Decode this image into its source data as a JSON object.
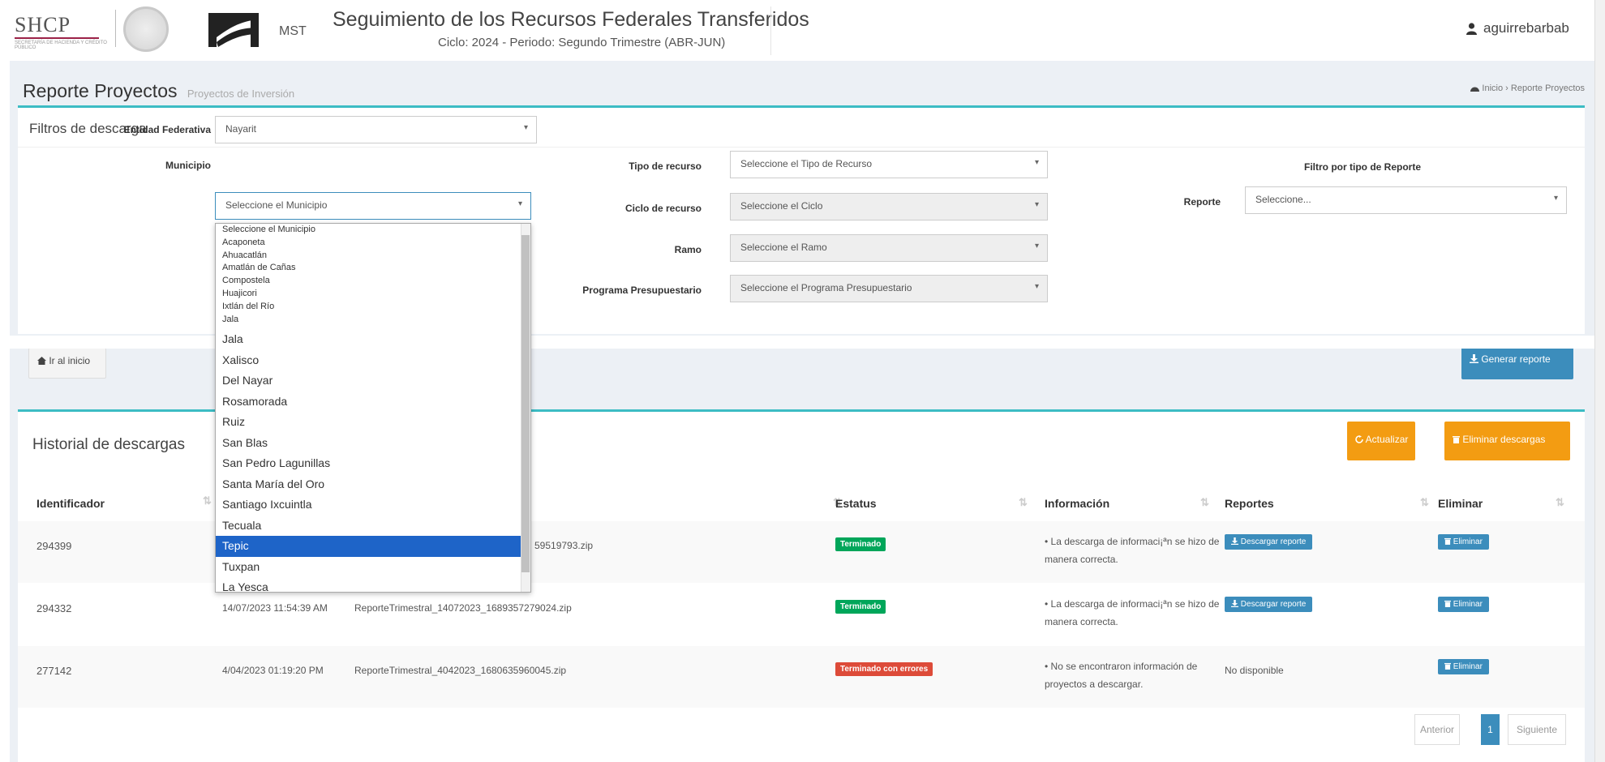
{
  "header": {
    "shcp_logo": "SHCP",
    "shcp_logo_sub": "SECRETARÍA DE HACIENDA Y CRÉDITO PÚBLICO",
    "mst_label": "MST",
    "title": "Seguimiento de los Recursos Federales Transferidos",
    "subtitle": "Ciclo: 2024 - Periodo: Segundo Trimestre (ABR-JUN)",
    "user": "aguirrebarbab",
    "user_icon": "user-icon"
  },
  "page": {
    "title": "Reporte Proyectos",
    "subtitle": "Proyectos de Inversión",
    "breadcrumb_home": "Inicio",
    "breadcrumb_current": "Reporte Proyectos",
    "breadcrumb_sep": "›",
    "home_icon": "dashboard-icon"
  },
  "filters": {
    "box_title": "Filtros de descarga",
    "entidad_label": "Entidad Federativa",
    "entidad_value": "Nayarit",
    "municipio_label": "Municipio",
    "municipio_placeholder": "Seleccione el Municipio",
    "tipo_label": "Tipo de recurso",
    "tipo_placeholder": "Seleccione el Tipo de Recurso",
    "ciclo_label": "Ciclo de recurso",
    "ciclo_placeholder": "Seleccione el Ciclo",
    "ramo_label": "Ramo",
    "ramo_placeholder": "Seleccione el Ramo",
    "programa_label": "Programa Presupuestario",
    "programa_placeholder": "Seleccione el Programa Presupuestario",
    "filtro_reporte_heading": "Filtro por tipo de Reporte",
    "reporte_label": "Reporte",
    "reporte_placeholder": "Seleccione...",
    "caret": "▾"
  },
  "municipio_options": {
    "small": [
      "Seleccione el Municipio",
      "Acaponeta",
      "Ahuacatlán",
      "Amatlán de Cañas",
      "Compostela",
      "Huajicori",
      "Ixtlán del Río",
      "Jala"
    ],
    "large": [
      "Jala",
      "Xalisco",
      "Del Nayar",
      "Rosamorada",
      "Ruiz",
      "San Blas",
      "San Pedro Lagunillas",
      "Santa María del Oro",
      "Santiago Ixcuintla",
      "Tecuala",
      "Tepic",
      "Tuxpan",
      "La Yesca"
    ],
    "selected": "Tepic"
  },
  "actions": {
    "home_button": "Ir al inicio",
    "home_button_icon": "home-icon",
    "generate_button": "Generar reporte",
    "generate_icon": "download-icon"
  },
  "history": {
    "title": "Historial de descargas",
    "refresh_button": "Actualizar",
    "refresh_icon": "refresh-icon",
    "delete_all_button": "Eliminar descargas",
    "delete_icon": "trash-icon",
    "columns": [
      "Identificador",
      "Estatus",
      "Información",
      "Reportes",
      "Eliminar"
    ],
    "sort_icon": "⇅",
    "rows": [
      {
        "id": "294399",
        "date": "",
        "file": "59519793.zip",
        "status": "Terminado",
        "status_color": "#00a65a",
        "info": "• La descarga de informaci¡ªn se hizo de manera correcta.",
        "report": "Descargar reporte",
        "delete": "Eliminar"
      },
      {
        "id": "294332",
        "date": "14/07/2023 11:54:39 AM",
        "file": "ReporteTrimestral_14072023_1689357279024.zip",
        "status": "Terminado",
        "status_color": "#00a65a",
        "info": "• La descarga de informaci¡ªn se hizo de manera correcta.",
        "report": "Descargar reporte",
        "delete": "Eliminar"
      },
      {
        "id": "277142",
        "date": "4/04/2023 01:19:20 PM",
        "file": "ReporteTrimestral_4042023_1680635960045.zip",
        "status": "Terminado con errores",
        "status_color": "#dd4b39",
        "info": "• No se encontraron información de proyectos a descargar.",
        "report": "No disponible",
        "delete": "Eliminar"
      }
    ],
    "pagination": {
      "prev": "Anterior",
      "current": "1",
      "next": "Siguiente"
    }
  },
  "colors": {
    "accent": "#3cbcc4",
    "primary_button": "#3c8dbc",
    "warning_button": "#f39c12",
    "success": "#00a65a",
    "danger": "#dd4b39",
    "selected_option": "#1e64c8"
  }
}
